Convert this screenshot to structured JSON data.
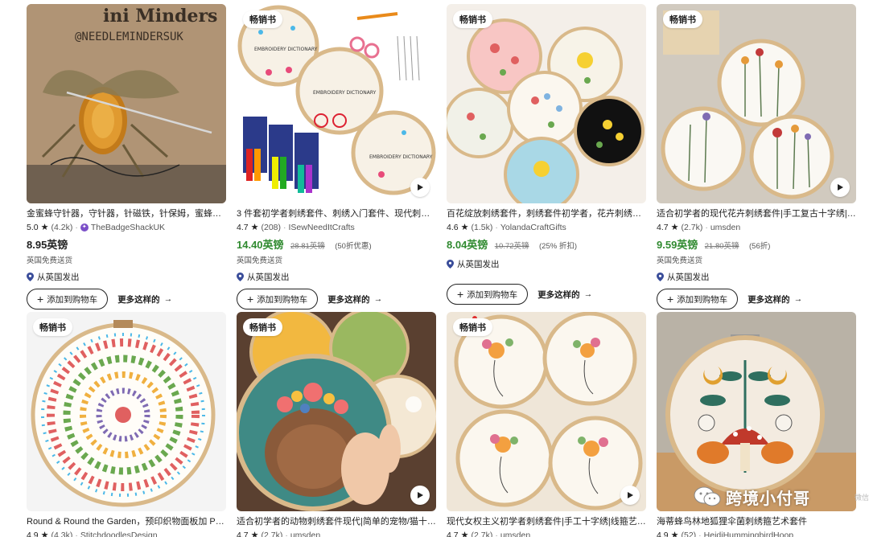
{
  "icons": {
    "star": "★",
    "arrow": "→",
    "plus": "+",
    "location": "map-pin-icon",
    "play": "play-icon"
  },
  "colors": {
    "sale_price": "#2f8a2f",
    "seller_badge": "#7b4fc8",
    "text": "#222222"
  },
  "labels": {
    "add_to_cart": "添加到购物车",
    "more_like_this": "更多这样的",
    "badge_bestseller": "畅销书",
    "free_shipping": "英国免费送货",
    "ships_from": "从英国发出"
  },
  "products": [
    {
      "title": "金蜜蜂守针器，守针器，针磁铁，针保姆，蜜蜂守…",
      "rating": "5.0",
      "reviews": "(4.2k)",
      "seller": "TheBadgeShackUK",
      "price": "8.95英镑"
    },
    {
      "badge": "畅销书",
      "title": "3 件套初学者刺绣套件、刺绣入门套件、现代刺绣…",
      "rating": "4.7",
      "reviews": "(208)",
      "seller": "ISewNeedItCrafts",
      "price": "14.40英镑",
      "original_price": "28.81英镑",
      "discount": "(50折优惠)"
    },
    {
      "badge": "畅销书",
      "title": "百花绽放刺绣套件，刺绣套件初学者，花卉刺绣套…",
      "rating": "4.6",
      "reviews": "(1.5k)",
      "seller": "YolandaCraftGifts",
      "price": "8.04英镑",
      "original_price": "10.72英镑",
      "discount": "(25% 折扣)"
    },
    {
      "badge": "畅销书",
      "title": "适合初学者的现代花卉刺绣套件|手工复古十字绣|…",
      "rating": "4.7",
      "reviews": "(2.7k)",
      "seller": "umsden",
      "price": "9.59英镑",
      "original_price": "21.80英镑",
      "discount": "(56折)"
    },
    {
      "badge": "畅销书",
      "title": "Round & Round the Garden，预印织物面板加 P…",
      "rating": "4.9",
      "reviews": "(4.3k)",
      "seller": "StitchdoodlesDesign"
    },
    {
      "badge": "畅销书",
      "title": "适合初学者的动物刺绣套件现代|简单的宠物/猫十…",
      "rating": "4.7",
      "reviews": "(2.7k)",
      "seller": "umsden"
    },
    {
      "badge": "畅销书",
      "title": "现代女权主义初学者刺绣套件|手工十字绣|线箍艺…",
      "rating": "4.7",
      "reviews": "(2.7k)",
      "seller": "umsden"
    },
    {
      "title": "海蒂蜂鸟林地狐狸伞菌刺绣箍艺术套件",
      "rating": "4.9",
      "reviews": "(52)",
      "seller": "HeidiHummingbirdHoop"
    }
  ],
  "watermark": {
    "text": "跨境小付哥",
    "side_text": "微信"
  }
}
